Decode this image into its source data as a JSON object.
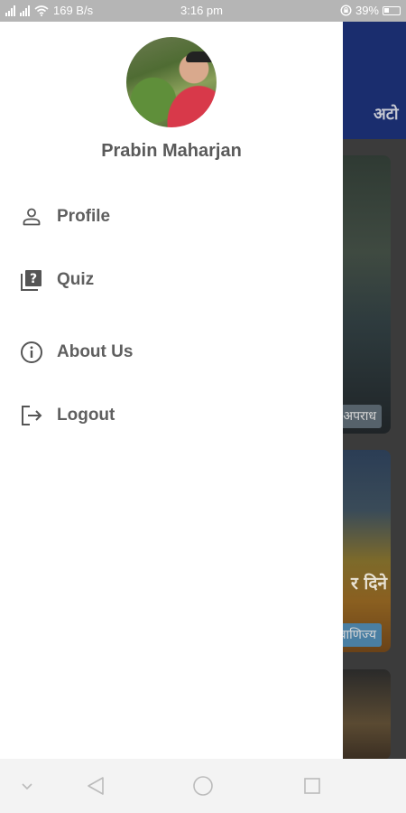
{
  "status_bar": {
    "signal_text": "",
    "speed": "169 B/s",
    "time": "3:16 pm",
    "battery": "39%"
  },
  "drawer": {
    "user_name": "Prabin Maharjan",
    "menu": [
      {
        "label": "Profile",
        "icon": "person-icon"
      },
      {
        "label": "Quiz",
        "icon": "quiz-icon"
      },
      {
        "label": "About Us",
        "icon": "info-icon"
      },
      {
        "label": "Logout",
        "icon": "logout-icon"
      }
    ]
  },
  "background": {
    "app_bar_title": "अटो",
    "card1_tag": "अपराध",
    "card2_headline": "र दिने",
    "card2_tag": "वाणिज्य"
  },
  "colors": {
    "drawer_bg": "#ffffff",
    "text": "#5f5f5f",
    "app_bar": "#1a2d6e",
    "status_bar": "#b5b5b5"
  }
}
